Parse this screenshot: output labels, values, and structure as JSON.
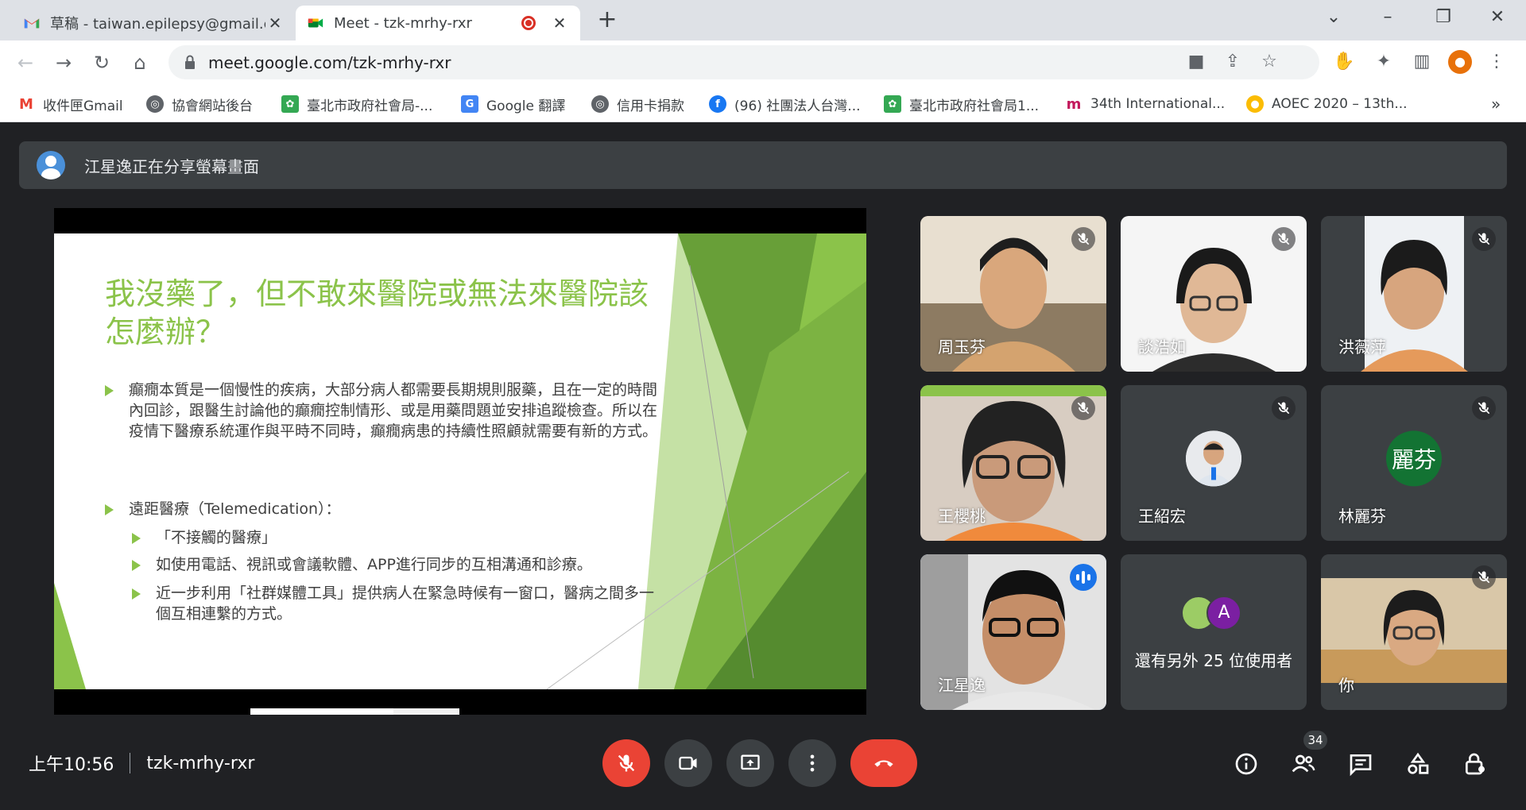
{
  "browser": {
    "tabs": [
      {
        "title": "草稿 - taiwan.epilepsy@gmail.c",
        "icon": "gmail-icon"
      },
      {
        "title": "Meet - tzk-mrhy-rxr",
        "icon": "meet-icon",
        "recording": true
      }
    ],
    "url": "meet.google.com/tzk-mrhy-rxr"
  },
  "bookmarks": [
    {
      "label": "收件匣Gmail",
      "icon": "gmail-icon"
    },
    {
      "label": "協會網站後台",
      "icon": "globe-icon"
    },
    {
      "label": "臺北市政府社會局-...",
      "icon": "taipei-icon"
    },
    {
      "label": "Google 翻譯",
      "icon": "translate-icon"
    },
    {
      "label": "信用卡捐款",
      "icon": "globe-icon"
    },
    {
      "label": "(96) 社團法人台灣...",
      "icon": "facebook-icon"
    },
    {
      "label": "臺北市政府社會局1...",
      "icon": "taipei-icon"
    },
    {
      "label": "34th International...",
      "icon": "m-logo-icon"
    },
    {
      "label": "AOEC 2020 – 13th...",
      "icon": "aoec-icon"
    }
  ],
  "presenter": {
    "text": "江星逸正在分享螢幕畫面"
  },
  "slide": {
    "title": "我沒藥了，但不敢來醫院或無法來醫院該怎麼辦？",
    "bullet1": "癲癇本質是一個慢性的疾病，大部分病人都需要長期規則服藥，且在一定的時間內回診，跟醫生討論他的癲癇控制情形、或是用藥問題並安排追蹤檢查。所以在疫情下醫療系統運作與平時不同時，癲癇病患的持續性照顧就需要有新的方式。",
    "bullet2": "遠距醫療（Telemedication）：",
    "sub1": "「不接觸的醫療」",
    "sub2": "如使用電話、視訊或會議軟體、APP進行同步的互相溝通和診療。",
    "sub3": "近一步利用「社群媒體工具」提供病人在緊急時候有一窗口，醫病之間多一個互相連繫的方式。"
  },
  "participants": [
    {
      "name": "周玉芬",
      "muted": true
    },
    {
      "name": "談浩如",
      "muted": true
    },
    {
      "name": "洪薇萍",
      "muted": true
    },
    {
      "name": "王櫻桃",
      "muted": true
    },
    {
      "name": "王紹宏",
      "muted": true
    },
    {
      "name": "林麗芬",
      "muted": true,
      "avatar_text": "麗芬",
      "avatar_color": "#137333"
    },
    {
      "name": "江星逸",
      "speaking": true
    },
    {
      "name": "還有另外 25 位使用者",
      "avatar_letter": "A",
      "avatar_color": "#7b1fa2"
    },
    {
      "name": "你",
      "muted": true
    }
  ],
  "controls": {
    "time": "上午10:56",
    "meeting_code": "tzk-mrhy-rxr",
    "people_count": "34"
  },
  "colors": {
    "accent_green": "#8bc34a",
    "end_call": "#ea4335",
    "meet_bg": "#202124",
    "tile_bg": "#3c4043"
  }
}
